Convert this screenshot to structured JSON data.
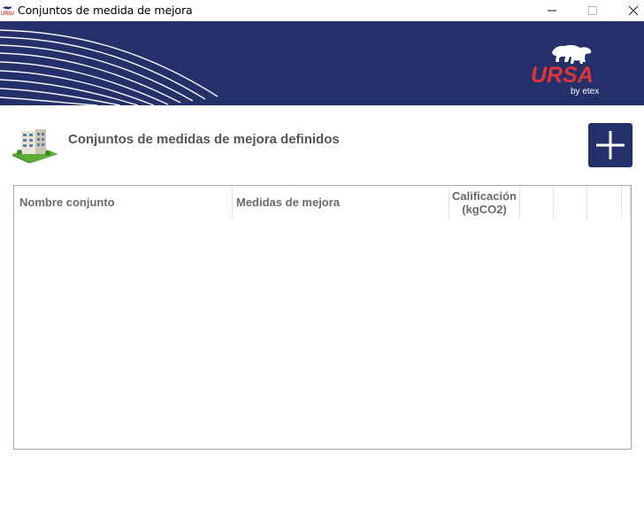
{
  "window": {
    "title": "Conjuntos de medida de mejora",
    "minimize": "—",
    "maximize": "☐",
    "close": "✕"
  },
  "banner": {
    "brand": "URSA",
    "tagline": "by etex",
    "brand_color": "#e0343a",
    "background": "#24306a"
  },
  "section": {
    "title": "Conjuntos de medidas de mejora definidos",
    "add_icon": "plus-icon"
  },
  "table": {
    "columns": [
      "Nombre conjunto",
      "Medidas de mejora",
      "Calificación",
      "(kgCO2)"
    ],
    "rows": []
  }
}
